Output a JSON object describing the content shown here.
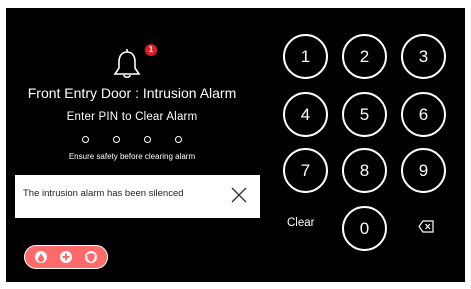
{
  "alarm": {
    "badge_count": "1",
    "title": "Front Entry Door : Intrusion Alarm",
    "prompt": "Enter PIN to Clear Alarm",
    "hint": "Ensure safety before clearing alarm",
    "pin_length": 4
  },
  "toast": {
    "message": "The intrusion alarm has been silenced"
  },
  "keypad": {
    "keys": [
      "1",
      "2",
      "3",
      "4",
      "5",
      "6",
      "7",
      "8",
      "9",
      "0"
    ],
    "clear_label": "Clear"
  },
  "emergency_icons": [
    "fire-icon",
    "medical-icon",
    "police-icon"
  ],
  "colors": {
    "background": "#000000",
    "alert_red": "#e31b23",
    "emergency_pink": "#ff6b6b"
  }
}
